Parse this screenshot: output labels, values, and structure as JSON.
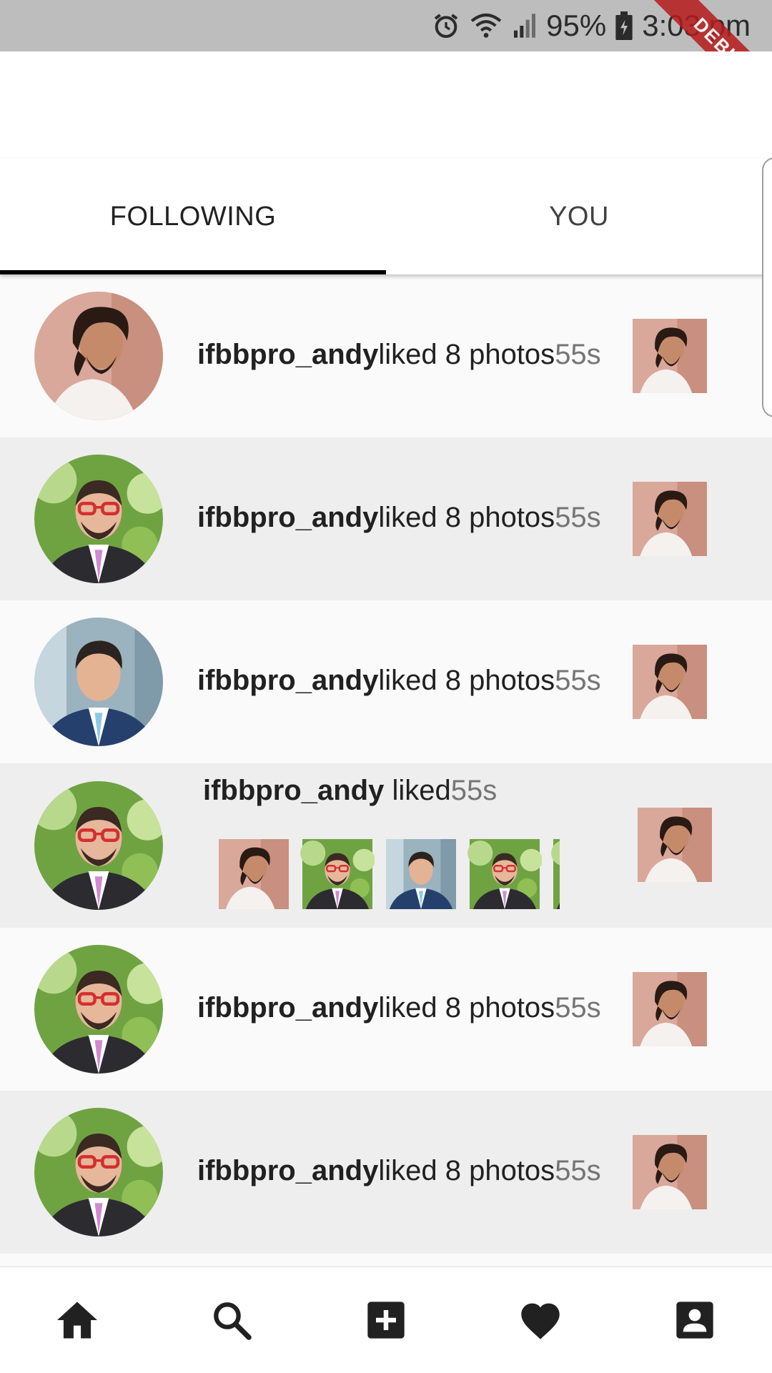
{
  "status_bar": {
    "battery": "95%",
    "time": "3:03 pm",
    "debug_label": "DEBUG"
  },
  "tabs": [
    {
      "label": "FOLLOWING",
      "active": true
    },
    {
      "label": "YOU",
      "active": false
    }
  ],
  "feed": [
    {
      "avatar": "portrait-long-hair-beard",
      "username": "ifbbpro_andy",
      "action": "liked 8 photos",
      "time": "55s",
      "thumbnail": "portrait-long-hair-beard"
    },
    {
      "avatar": "portrait-red-glasses",
      "username": "ifbbpro_andy",
      "action": "liked 8 photos",
      "time": "55s",
      "thumbnail": "portrait-long-hair-beard"
    },
    {
      "avatar": "portrait-blue-suit",
      "username": "ifbbpro_andy",
      "action": "liked 8 photos",
      "time": "55s",
      "thumbnail": "portrait-long-hair-beard"
    },
    {
      "avatar": "portrait-red-glasses",
      "username": "ifbbpro_andy",
      "action": "liked",
      "time": "55s",
      "thumbnail": "portrait-long-hair-beard",
      "liked_photos": [
        "portrait-long-hair-beard",
        "portrait-red-glasses",
        "portrait-blue-suit",
        "portrait-red-glasses",
        "portrait-partial"
      ]
    },
    {
      "avatar": "portrait-red-glasses",
      "username": "ifbbpro_andy",
      "action": "liked 8 photos",
      "time": "55s",
      "thumbnail": "portrait-long-hair-beard"
    },
    {
      "avatar": "portrait-red-glasses",
      "username": "ifbbpro_andy",
      "action": "liked 8 photos",
      "time": "55s",
      "thumbnail": "portrait-long-hair-beard"
    }
  ],
  "bottom_nav": [
    {
      "icon": "home-icon"
    },
    {
      "icon": "search-icon"
    },
    {
      "icon": "add-box-icon"
    },
    {
      "icon": "heart-icon"
    },
    {
      "icon": "account-box-icon"
    }
  ],
  "colors": {
    "tab_indicator": "#000000",
    "row_alt": "#eeeeee",
    "row_base": "#fafafa",
    "debug": "#b71c1c"
  }
}
